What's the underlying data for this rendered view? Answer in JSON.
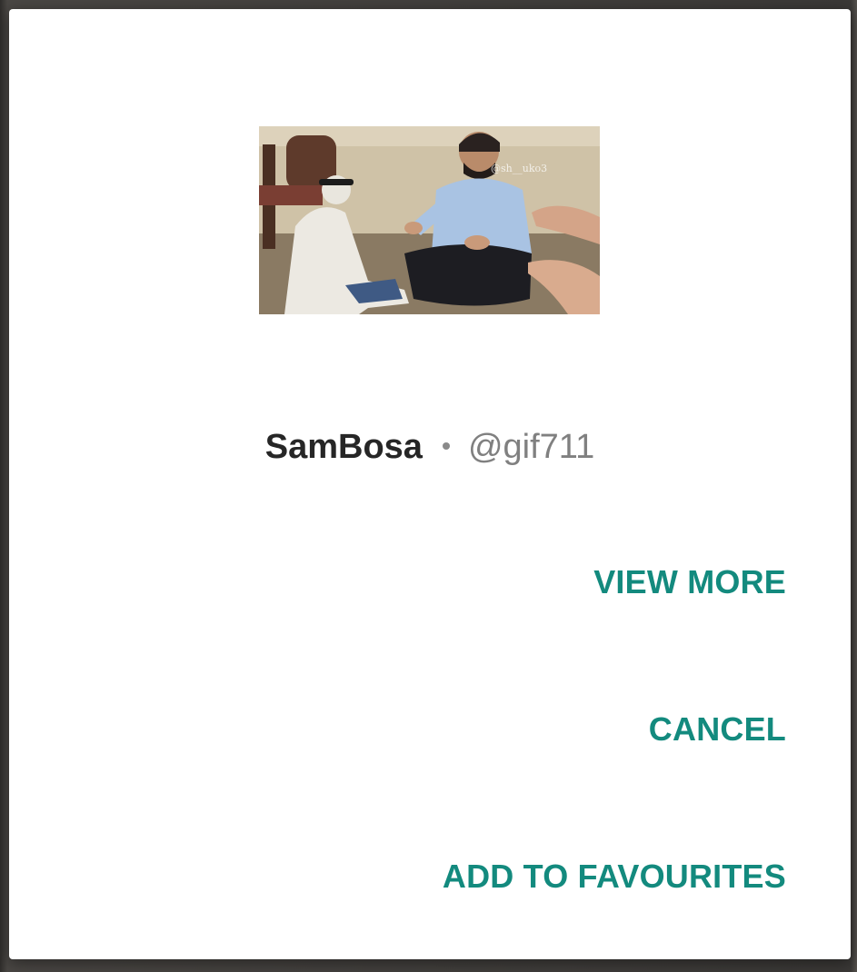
{
  "dialog": {
    "preview": {
      "alt": "GIF preview",
      "watermark": "@sh__uko3"
    },
    "author": {
      "name": "SamBosa",
      "handle": "@gif711"
    },
    "actions": {
      "view_more": "VIEW MORE",
      "cancel": "CANCEL",
      "add_to_favourites": "ADD TO FAVOURITES"
    },
    "colors": {
      "accent": "#138a7e",
      "name_text": "#262626",
      "handle_text": "#808080",
      "surface": "#ffffff"
    }
  }
}
